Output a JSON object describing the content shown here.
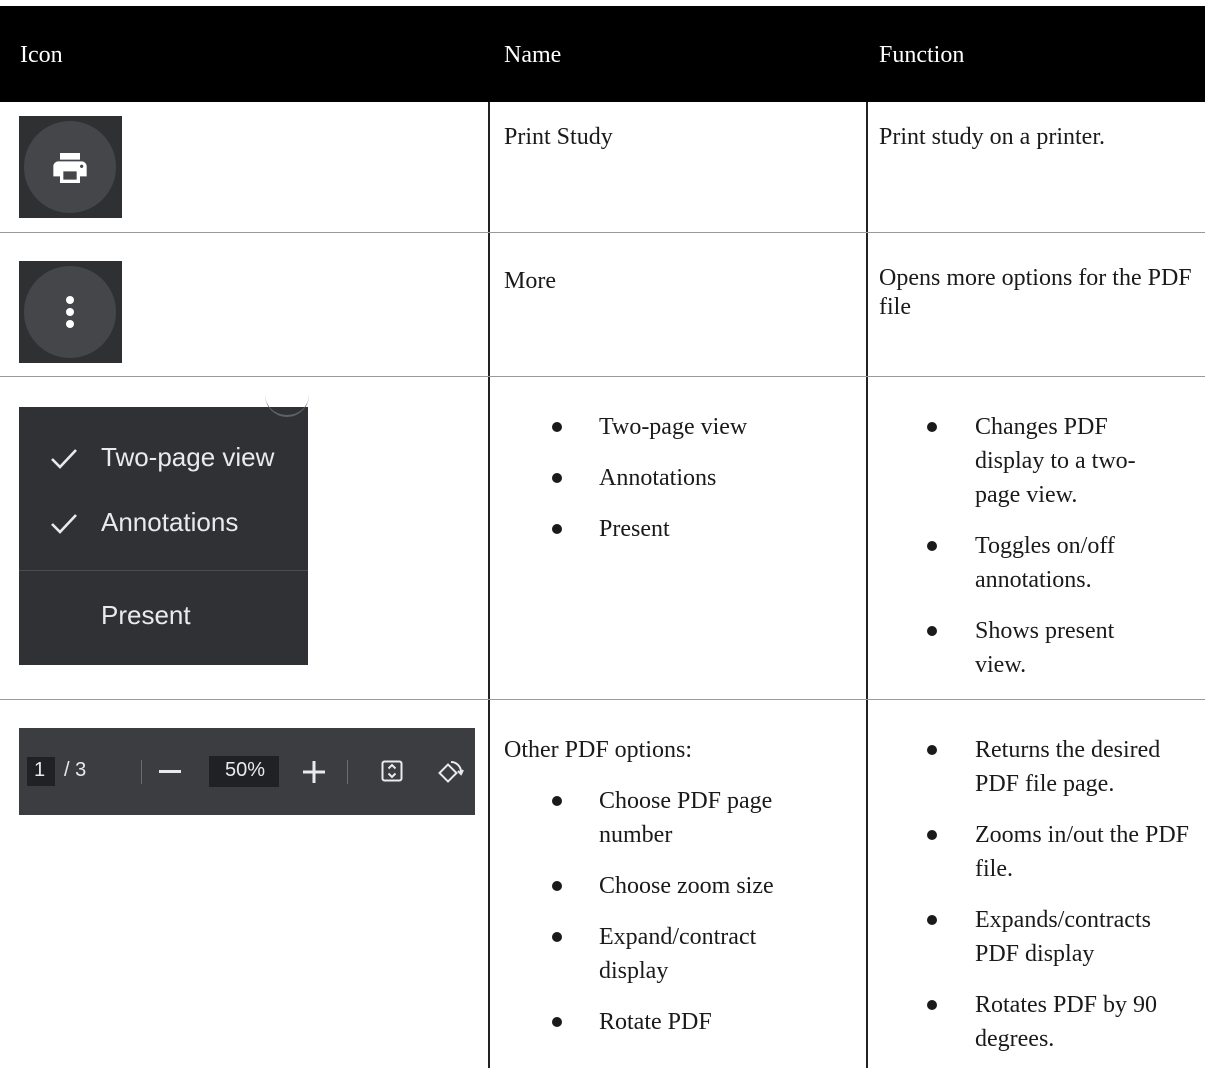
{
  "table": {
    "headers": [
      "Icon",
      "Name",
      "Function"
    ],
    "rows": [
      {
        "icon": "print-icon",
        "name": "Print Study",
        "function": "Print study on a printer."
      },
      {
        "icon": "more-vertical-icon",
        "name": "More",
        "function": "Opens more options for the PDF file"
      },
      {
        "icon_menu": {
          "items": [
            "Two-page view",
            "Annotations",
            "Present"
          ]
        },
        "name_items": [
          "Two-page view",
          "Annotations",
          "Present"
        ],
        "function_items": [
          "Changes PDF display to a two-page view.",
          "Toggles on/off annotations.",
          "Shows present view."
        ]
      },
      {
        "toolbar": {
          "page_current": "1",
          "page_total": "/ 3",
          "zoom": "50%",
          "minus": "—",
          "plus": "+"
        },
        "name_intro": "Other PDF options:",
        "name_items": [
          "Choose PDF page number",
          "Choose zoom size",
          "Expand/contract display",
          "Rotate PDF"
        ],
        "function_items": [
          "Returns the desired PDF file page.",
          "Zooms in/out the PDF file.",
          "Expands/contracts PDF display",
          "Rotates PDF by 90 degrees."
        ]
      }
    ]
  }
}
